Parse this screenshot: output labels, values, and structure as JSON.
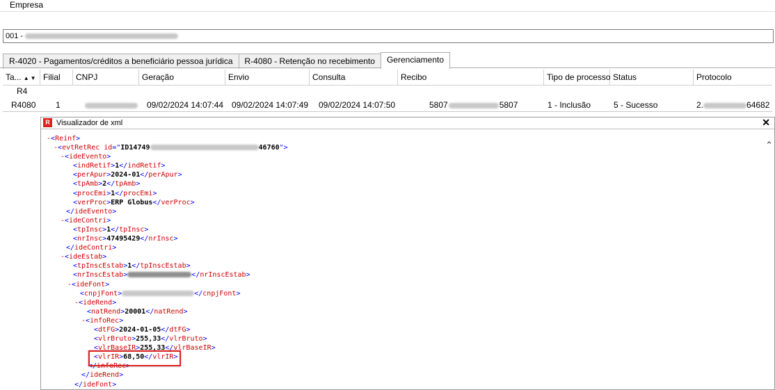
{
  "empresa": {
    "label": "Empresa",
    "value_prefix": "001 -"
  },
  "tabs": [
    {
      "label": "R-4020 - Pagamentos/créditos a beneficiário pessoa jurídica"
    },
    {
      "label": "R-4080 - Retenção no recebimento"
    },
    {
      "label": "Gerenciamento"
    }
  ],
  "grid": {
    "columns": [
      "Ta...",
      "Filial",
      "CNPJ",
      "Geração",
      "Envio",
      "Consulta",
      "Recibo",
      "Tipo de processo",
      "Status",
      "Protocolo"
    ],
    "group": "R4",
    "row": {
      "tabela": "R4080",
      "filial": "1",
      "geracao": "09/02/2024 14:07:44",
      "envio": "09/02/2024 14:07:49",
      "consulta": "09/02/2024 14:07:50",
      "recibo_start": "5807",
      "recibo_end": "5807",
      "tipo": "1 - Inclusão",
      "status": "5 - Sucesso",
      "protocolo_start": "2.",
      "protocolo_end": "64682"
    }
  },
  "xml_viewer": {
    "title": "Visualizador de xml",
    "icons": {
      "app": "reinf-app-icon",
      "close": "close-icon"
    },
    "colors": {
      "bracket": "#0000ff",
      "toggle": "#d00000",
      "highlight": "#e02020"
    },
    "lines": {
      "reinf": "Reinf",
      "evt_id_start": "ID14749",
      "evt_id_end": "46760",
      "indRetif": "1",
      "perApur": "2024-01",
      "tpAmb": "2",
      "procEmi": "1",
      "verProc": "ERP Globus",
      "tpInsc": "1",
      "nrInsc": "47495429",
      "tpInscEstab": "1",
      "natRend": "20001",
      "dtFG": "2024-01-05",
      "vlrBruto": "255,33",
      "vlrBaseIR": "255,33",
      "vlrIR": "68,50"
    }
  }
}
